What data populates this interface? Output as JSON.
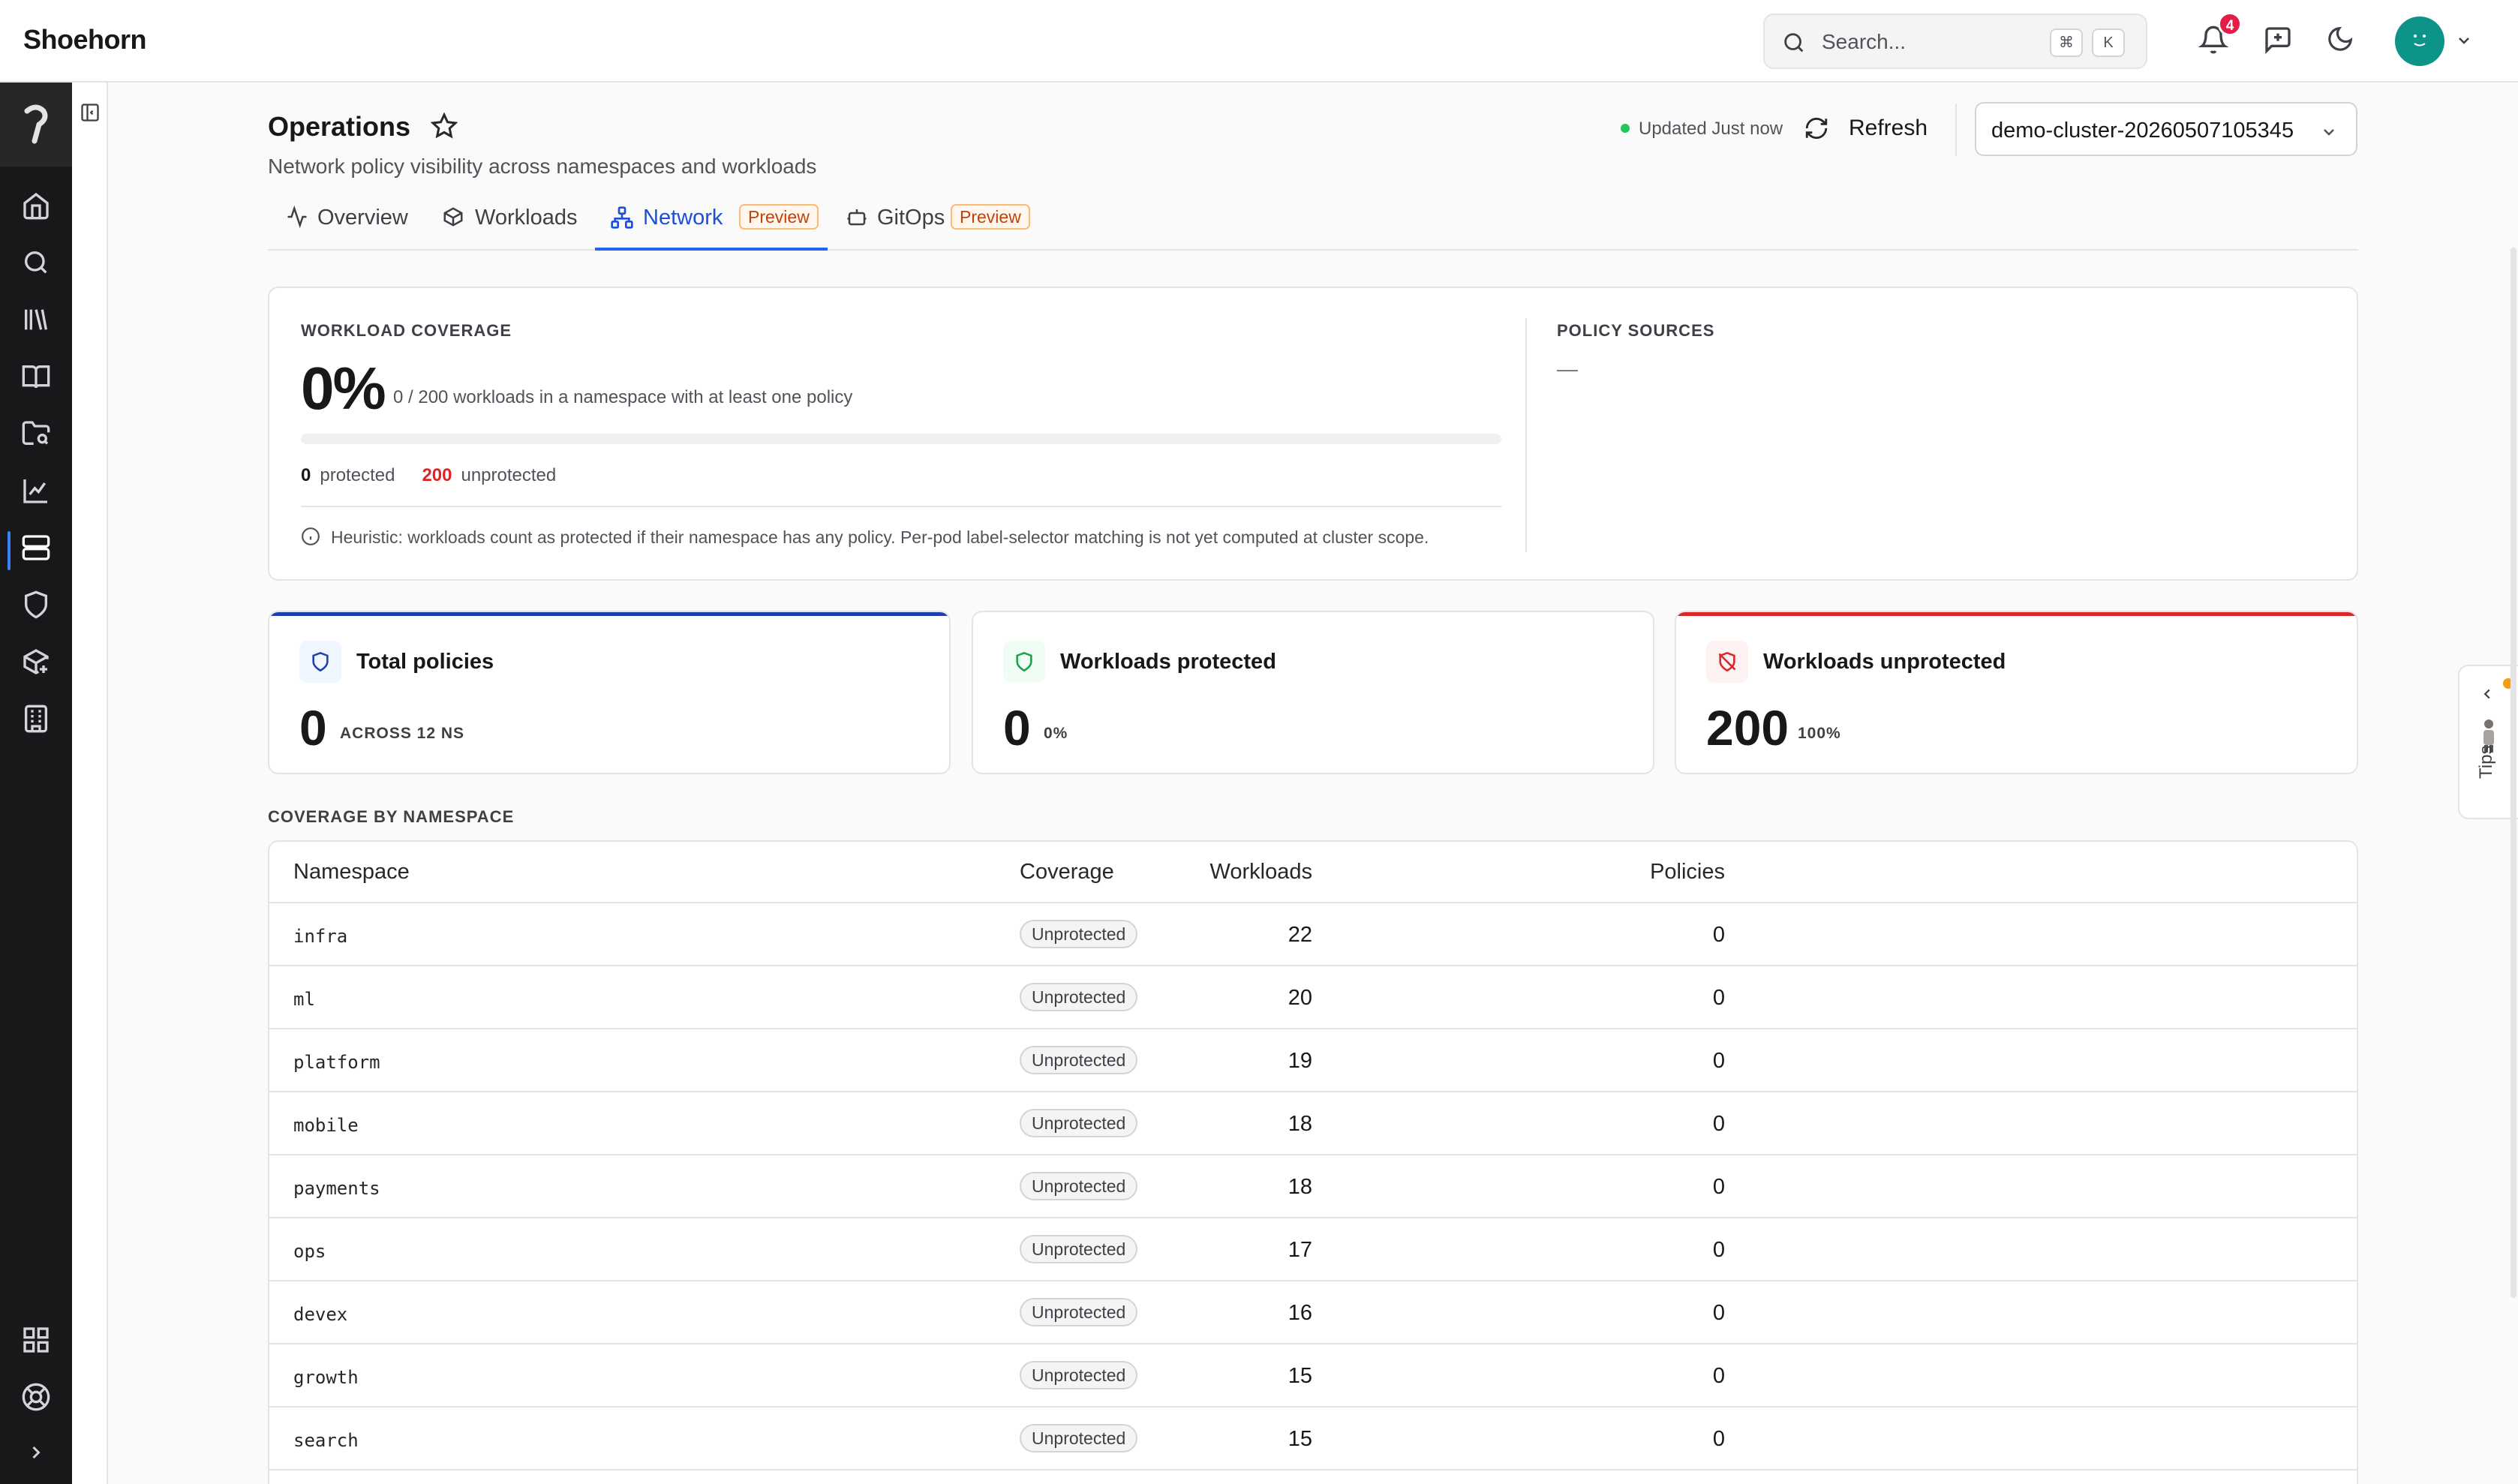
{
  "app": {
    "brand": "Shoehorn"
  },
  "search": {
    "placeholder": "Search...",
    "kbd_mod": "⌘",
    "kbd_key": "K"
  },
  "notifications": {
    "count": "4"
  },
  "header": {
    "title": "Operations",
    "subtitle": "Network policy visibility across namespaces and workloads",
    "updated": "Updated Just now",
    "refresh_label": "Refresh",
    "cluster": "demo-cluster-20260507105345"
  },
  "tabs": [
    {
      "label": "Overview",
      "icon": "activity-icon"
    },
    {
      "label": "Workloads",
      "icon": "box-icon"
    },
    {
      "label": "Network",
      "icon": "network-icon",
      "badge": "Preview",
      "active": true
    },
    {
      "label": "GitOps",
      "icon": "git-bot-icon",
      "badge": "Preview"
    }
  ],
  "coverage": {
    "heading": "WORKLOAD COVERAGE",
    "percent": "0%",
    "percent_value": 0,
    "description": "0 / 200 workloads in a namespace with at least one policy",
    "protected_count": "0",
    "protected_label": "protected",
    "unprotected_count": "200",
    "unprotected_label": "unprotected",
    "heuristic": "Heuristic: workloads count as protected if their namespace has any policy. Per-pod label-selector matching is not yet computed at cluster scope.",
    "sources_heading": "POLICY SOURCES",
    "sources_value": "—"
  },
  "stats": [
    {
      "title": "Total policies",
      "value": "0",
      "sub": "ACROSS 12 NS",
      "color": "#1e40af"
    },
    {
      "title": "Workloads protected",
      "value": "0",
      "sub": "0%",
      "color": "#16a34a"
    },
    {
      "title": "Workloads unprotected",
      "value": "200",
      "sub": "100%",
      "color": "#dc2626"
    }
  ],
  "table": {
    "title": "COVERAGE BY NAMESPACE",
    "headers": {
      "namespace": "Namespace",
      "workloads": "Workloads",
      "policies": "Policies",
      "coverage": "Coverage"
    },
    "rows": [
      {
        "namespace": "infra",
        "workloads": "22",
        "policies": "0",
        "coverage": "Unprotected"
      },
      {
        "namespace": "ml",
        "workloads": "20",
        "policies": "0",
        "coverage": "Unprotected"
      },
      {
        "namespace": "platform",
        "workloads": "19",
        "policies": "0",
        "coverage": "Unprotected"
      },
      {
        "namespace": "mobile",
        "workloads": "18",
        "policies": "0",
        "coverage": "Unprotected"
      },
      {
        "namespace": "payments",
        "workloads": "18",
        "policies": "0",
        "coverage": "Unprotected"
      },
      {
        "namespace": "ops",
        "workloads": "17",
        "policies": "0",
        "coverage": "Unprotected"
      },
      {
        "namespace": "devex",
        "workloads": "16",
        "policies": "0",
        "coverage": "Unprotected"
      },
      {
        "namespace": "growth",
        "workloads": "15",
        "policies": "0",
        "coverage": "Unprotected"
      },
      {
        "namespace": "search",
        "workloads": "15",
        "policies": "0",
        "coverage": "Unprotected"
      }
    ]
  },
  "tips": {
    "label": "Tips"
  },
  "colors": {
    "accent": "#2563eb",
    "danger": "#dc2626",
    "success": "#22c55e",
    "rail": "#18181b"
  }
}
